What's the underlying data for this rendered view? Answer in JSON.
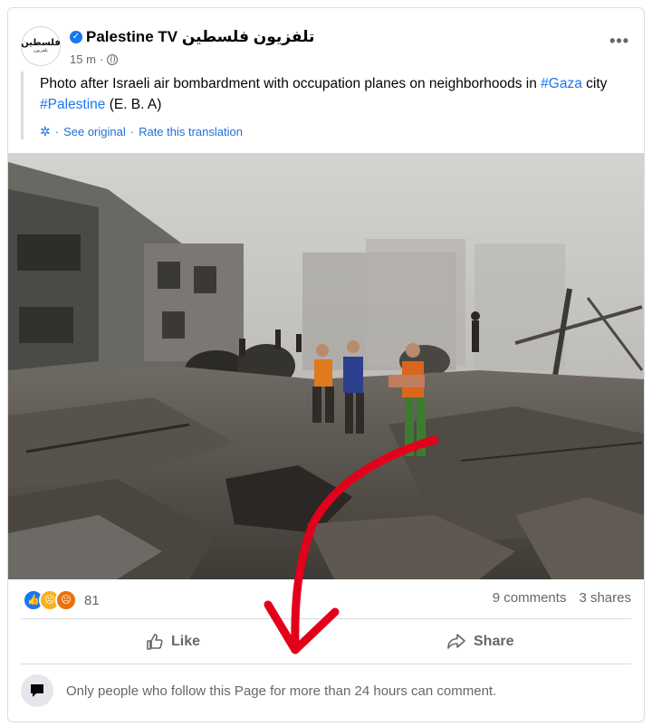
{
  "post": {
    "page_name": "Palestine TV تلفزيون فلسطين",
    "avatar_text_top": "فلسطين",
    "avatar_text_bottom": "تلفزيون",
    "time": "15 m",
    "separator": "·",
    "more_label": "•••",
    "text_before": "Photo after Israeli air bombardment with occupation planes on neighborhoods in ",
    "hashtag_gaza": "#Gaza",
    "text_middle": " city ",
    "hashtag_palestine": "#Palestine",
    "text_after": " (E. B. A)",
    "see_original": "See original",
    "dot": "·",
    "rate_translation": "Rate this translation"
  },
  "engagement": {
    "reaction_count": "81",
    "comments": "9 comments",
    "shares": "3 shares"
  },
  "actions": {
    "like_label": "Like",
    "share_label": "Share"
  },
  "comment_notice": "Only people who follow this Page for more than 24 hours can comment.",
  "colors": {
    "accent": "#1877f2",
    "arrow": "#e3001b"
  }
}
